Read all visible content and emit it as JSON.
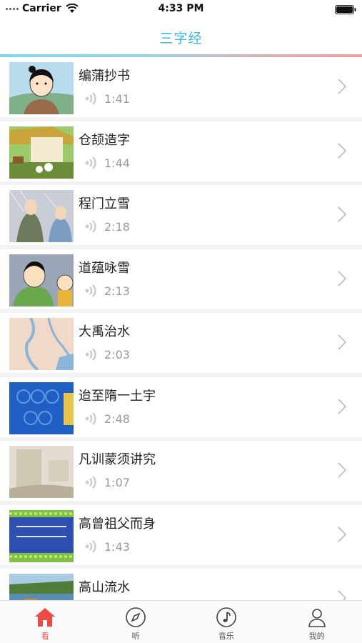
{
  "status_bar": {
    "carrier": "Carrier",
    "time": "4:33 PM"
  },
  "nav": {
    "title": "三字经",
    "accent_color": "#3db7e4"
  },
  "items": [
    {
      "title": "编蒲抄书",
      "duration": "1:41"
    },
    {
      "title": "仓颉造字",
      "duration": "1:44"
    },
    {
      "title": "程门立雪",
      "duration": "2:18"
    },
    {
      "title": "道蕴咏雪",
      "duration": "2:13"
    },
    {
      "title": "大禹治水",
      "duration": "2:03"
    },
    {
      "title": "迨至隋一土宇",
      "duration": "2:48"
    },
    {
      "title": "凡训蒙须讲究",
      "duration": "1:07"
    },
    {
      "title": "高曾祖父而身",
      "duration": "1:43"
    },
    {
      "title": "高山流水",
      "duration": ""
    }
  ],
  "tabs": [
    {
      "label": "看",
      "icon": "home-icon",
      "active": true
    },
    {
      "label": "听",
      "icon": "compass-icon",
      "active": false
    },
    {
      "label": "音乐",
      "icon": "music-note-icon",
      "active": false
    },
    {
      "label": "我的",
      "icon": "user-icon",
      "active": false
    }
  ],
  "colors": {
    "active_tab": "#e94b45",
    "duration_text": "#999999"
  }
}
